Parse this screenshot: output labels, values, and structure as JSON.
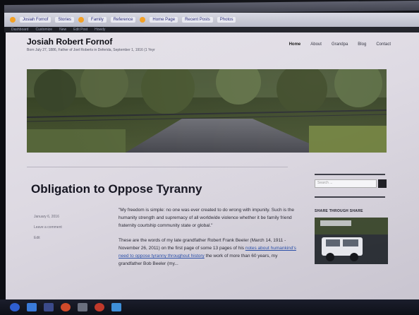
{
  "browser": {
    "bookmarks": [
      "Josiah Fornof",
      "Stories",
      "Family",
      "Reference",
      "Home Page",
      "Recent Posts",
      "Photos"
    ]
  },
  "admin_bar": {
    "items": [
      "Dashboard",
      "Customize",
      "New",
      "Edit Post",
      "Howdy"
    ]
  },
  "site": {
    "title": "Josiah Robert Fornof",
    "subtitle": "Born July 27, 1886, Father of Joel Roberts in Deferida, September 1, 1916 (1 Yeyr"
  },
  "nav": {
    "items": [
      "Home",
      "About",
      "Grandpa",
      "Blog",
      "Contact"
    ]
  },
  "post": {
    "title": "Obligation to Oppose Tyranny",
    "meta": [
      "January 6, 2016",
      "Leave a comment",
      "Edit"
    ],
    "paragraphs": [
      "\"My freedom is simple: no one was ever created to do wrong with impunity. Such is the humanity strength and supremacy of all worldwide violence whether it be family friend fraternity courtship community state or global.\"",
      "These are the words of my late grandfather Robert Frank Beeler (March 14, 1911 - November 26, 2011) on the first page of some 13 pages of his"
    ],
    "link_text": "notes about humankind's need to oppose tyranny throughout history",
    "trailing": "the work of more than 60 years, my grandfather Bob Beeler (my..."
  },
  "sidebar": {
    "search_placeholder": "Search ...",
    "widget_title": "SHARE THROUGH SHARE"
  },
  "colors": {
    "accent_link": "#2b4fa8",
    "title": "#161622",
    "page_bg": "#e2dfe6"
  }
}
